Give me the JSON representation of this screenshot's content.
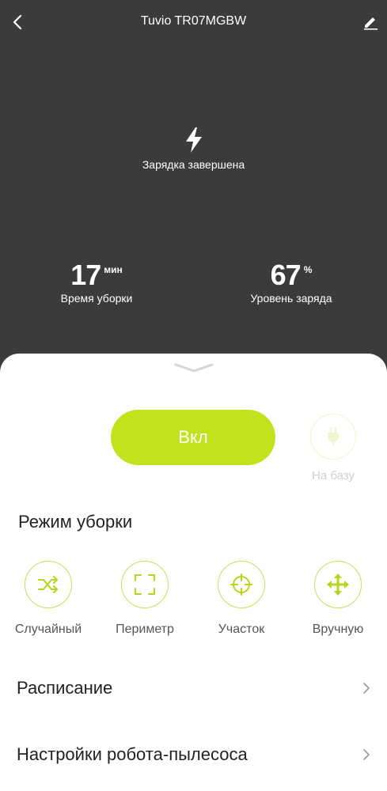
{
  "header": {
    "title": "Tuvio TR07MGBW"
  },
  "status": {
    "charge_text": "Зарядка завершена"
  },
  "stats": {
    "time": {
      "value": "17",
      "unit": "мин",
      "label": "Время уборки"
    },
    "battery": {
      "value": "67",
      "unit": "%",
      "label": "Уровень заряда"
    }
  },
  "controls": {
    "power_label": "Вкл",
    "dock_label": "На базу"
  },
  "modes": {
    "title": "Режим уборки",
    "items": [
      {
        "label": "Случайный",
        "icon": "shuffle-icon"
      },
      {
        "label": "Периметр",
        "icon": "frame-icon"
      },
      {
        "label": "Участок",
        "icon": "target-icon"
      },
      {
        "label": "Вручную",
        "icon": "move-arrows-icon"
      }
    ]
  },
  "menu": {
    "items": [
      {
        "label": "Расписание"
      },
      {
        "label": "Настройки робота-пылесоса"
      }
    ]
  },
  "colors": {
    "accent": "#c3e11c",
    "header_bg": "#3b3b3b",
    "mode_icon": "#b5d41c"
  }
}
